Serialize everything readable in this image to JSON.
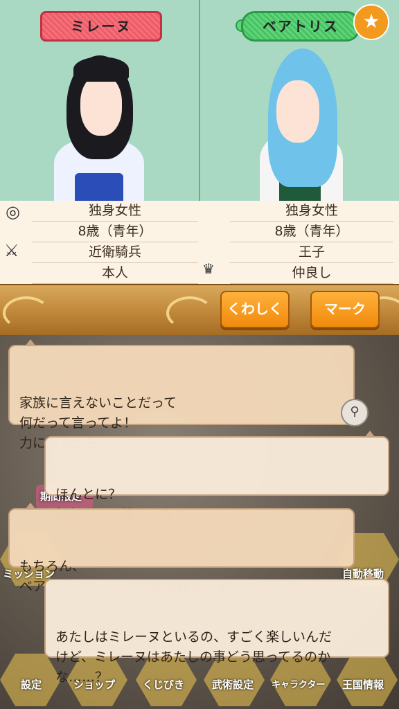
{
  "left_character": {
    "name": "ミレーヌ",
    "stats": [
      "独身女性",
      "8歳（青年）",
      "近衛騎兵",
      "本人"
    ]
  },
  "right_character": {
    "name": "ベアトリス",
    "stats": [
      "独身女性",
      "8歳（青年）",
      "王子",
      "仲良し"
    ]
  },
  "icons": {
    "marital": "ring-icon",
    "job": "crossed-swords-icon",
    "relationship": "crown-icon",
    "favorite": "star-icon"
  },
  "buttons": {
    "details": "くわしく",
    "mark": "マーク"
  },
  "background_menu": {
    "limited_label": "期間限定",
    "items": [
      "ミッション",
      "自動移動",
      "設定",
      "ショップ",
      "くじびき",
      "武術設定",
      "キャラクター",
      "王国情報"
    ]
  },
  "dialogue": [
    {
      "speaker": "right",
      "text": "家族に言えないことだって\n何だって言ってよ！\n力になるから"
    },
    {
      "speaker": "left",
      "text": "ほんとに？\n親友か……嬉しいな♪"
    },
    {
      "speaker": "right",
      "text": "もちろん、\nベアトリスちゃんは大切な親友だよ！"
    },
    {
      "speaker": "left",
      "text": "あたしはミレーヌといるの、すごく楽しいんだ\nけど、ミレーヌはあたしの事どう思ってるのか\nな……？"
    }
  ],
  "colors": {
    "panel_bg": "#a9d9c2",
    "left_tag": "#ec5c68",
    "right_tag": "#47c163",
    "bubble": "#f2d8b8",
    "button": "#f08a0c"
  }
}
